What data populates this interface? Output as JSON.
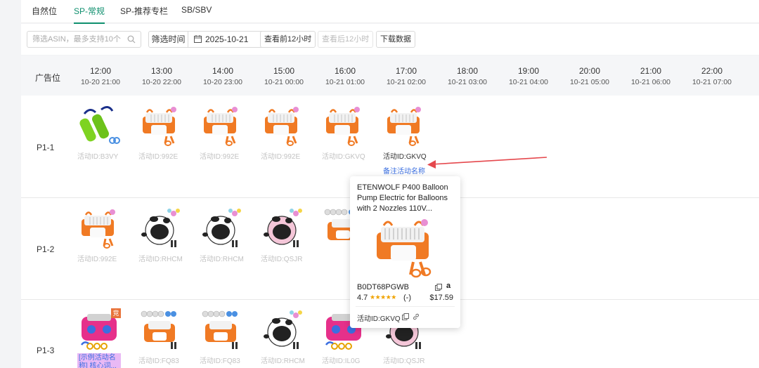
{
  "tabs": [
    {
      "label": "自然位",
      "active": false
    },
    {
      "label": "SP-常规",
      "active": true
    },
    {
      "label": "SP-推荐专栏",
      "active": false
    },
    {
      "label": "SB/SBV",
      "active": false
    }
  ],
  "filters": {
    "asin_placeholder": "筛选ASIN，最多支持10个",
    "time_label": "筛选时间",
    "date_value": "2025-10-21",
    "prev_button": "查看前12小时",
    "next_button": "查看后12小时",
    "download_button": "下载数据"
  },
  "table": {
    "position_header": "广告位",
    "times": [
      {
        "hour": "12:00",
        "date": "10-20 21:00"
      },
      {
        "hour": "13:00",
        "date": "10-20 22:00"
      },
      {
        "hour": "14:00",
        "date": "10-20 23:00"
      },
      {
        "hour": "15:00",
        "date": "10-21 00:00"
      },
      {
        "hour": "16:00",
        "date": "10-21 01:00"
      },
      {
        "hour": "17:00",
        "date": "10-21 02:00"
      },
      {
        "hour": "18:00",
        "date": "10-21 03:00"
      },
      {
        "hour": "19:00",
        "date": "10-21 04:00"
      },
      {
        "hour": "20:00",
        "date": "10-21 05:00"
      },
      {
        "hour": "21:00",
        "date": "10-21 06:00"
      },
      {
        "hour": "22:00",
        "date": "10-21 07:00"
      }
    ],
    "rows": [
      {
        "label": "P1-1",
        "cells": [
          {
            "product": "green-hand-pump",
            "campaign": "活动ID:B3VY"
          },
          {
            "product": "orange-balloon-pump",
            "campaign": "活动ID:992E"
          },
          {
            "product": "orange-balloon-pump",
            "campaign": "活动ID:992E"
          },
          {
            "product": "orange-balloon-pump",
            "campaign": "活动ID:992E"
          },
          {
            "product": "orange-balloon-pump",
            "campaign": "活动ID:GKVQ"
          },
          {
            "product": "orange-balloon-pump",
            "campaign": "活动ID:GKVQ",
            "note": "备注活动名称"
          }
        ]
      },
      {
        "label": "P1-2",
        "cells": [
          {
            "product": "orange-balloon-pump",
            "campaign": "活动ID:992E"
          },
          {
            "product": "cow-balloon-pump",
            "campaign": "活动ID:RHCM"
          },
          {
            "product": "cow-balloon-pump",
            "campaign": "活动ID:RHCM"
          },
          {
            "product": "pink-cow-pump",
            "campaign": "活动ID:QSJR"
          },
          {
            "product": "orange-pump-balloons",
            "campaign": ""
          }
        ]
      },
      {
        "label": "P1-3",
        "cells": [
          {
            "product": "pink-electric-pump",
            "campaign": "",
            "badge": "竞",
            "tag": "[示例活动名称] 核心词..."
          },
          {
            "product": "orange-pump-balloons",
            "campaign": "活动ID:FQ83"
          },
          {
            "product": "orange-pump-balloons",
            "campaign": "活动ID:FQ83"
          },
          {
            "product": "cow-balloon-pump",
            "campaign": "活动ID:RHCM"
          },
          {
            "product": "pink-electric-pump",
            "campaign": "活动ID:IL0G"
          },
          {
            "product": "pink-cow-pump",
            "campaign": "活动ID:QSJR"
          }
        ]
      }
    ]
  },
  "popover": {
    "title": "ETENWOLF P400 Balloon Pump Electric for Balloons with 2 Nozzles 110V...",
    "asin": "B0DT68PGWB",
    "amazon_mark": "a",
    "rating": "4.7",
    "stars": "★★★★★",
    "reviews": "(-)",
    "price": "$17.59",
    "campaign": "活动ID:GKVQ"
  },
  "colors": {
    "accent": "#0f8f6e",
    "link": "#3b6fe0",
    "arrow": "#e5484d"
  }
}
